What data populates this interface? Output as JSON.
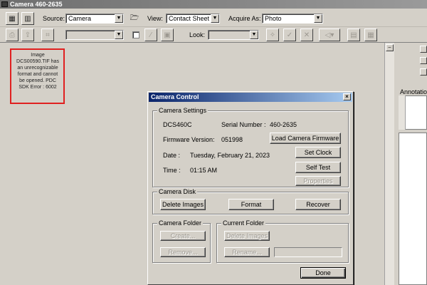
{
  "window": {
    "title": "Camera 460-2635"
  },
  "toolbar1": {
    "source_label": "Source:",
    "source_value": "Camera",
    "view_label": "View:",
    "view_value": "Contact Sheet",
    "acquire_label": "Acquire As:",
    "acquire_value": "Photo"
  },
  "toolbar2": {
    "look_label": "Look:"
  },
  "thumbnail": {
    "line1": "Image",
    "line2": "DCS00590.TIF has",
    "line3": "an unrecognizable",
    "line4": "format and cannot",
    "line5": "be opened. PDC",
    "line6": "SDK Error : 6002"
  },
  "annotation": {
    "label": "Annotation"
  },
  "dialog": {
    "title": "Camera Control",
    "close": "×",
    "settings": {
      "group_label": "Camera Settings",
      "model": "DCS460C",
      "serial_label": "Serial Number :",
      "serial_value": "460-2635",
      "firmware_label": "Firmware Version:",
      "firmware_value": "051998",
      "load_firmware": "Load Camera Firmware",
      "date_label": "Date :",
      "date_value": "Tuesday, February 21, 2023",
      "set_clock": "Set Clock",
      "time_label": "Time :",
      "time_value": "01:15 AM",
      "self_test": "Self Test",
      "properties": "Properties"
    },
    "disk": {
      "group_label": "Camera Disk",
      "delete_images": "Delete Images",
      "format": "Format",
      "recover": "Recover"
    },
    "camera_folder": {
      "group_label": "Camera Folder",
      "create": "Create...",
      "remove": "Remove..."
    },
    "current_folder": {
      "group_label": "Current Folder",
      "delete_images": "Delete Images",
      "rename": "Rename...",
      "name_value": ""
    },
    "done": "Done"
  }
}
